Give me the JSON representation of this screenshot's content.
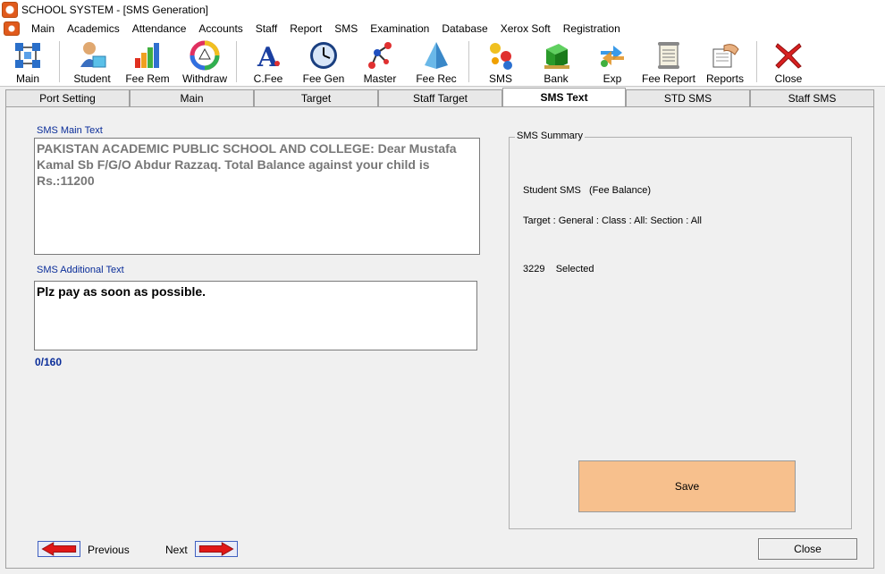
{
  "window": {
    "title": "SCHOOL SYSTEM - [SMS Generation]"
  },
  "menu": [
    "Main",
    "Academics",
    "Attendance",
    "Accounts",
    "Staff",
    "Report",
    "SMS",
    "Examination",
    "Database",
    "Xerox Soft",
    "Registration"
  ],
  "toolbar": [
    {
      "label": "Main",
      "icon": "grid-icon"
    },
    {
      "label": "Student",
      "icon": "student-icon"
    },
    {
      "label": "Fee Rem",
      "icon": "bar-chart-icon"
    },
    {
      "label": "Withdraw",
      "icon": "color-wheel-icon"
    },
    {
      "label": "C.Fee",
      "icon": "letter-a-icon"
    },
    {
      "label": "Fee Gen",
      "icon": "clock-icon"
    },
    {
      "label": "Master",
      "icon": "molecule-icon"
    },
    {
      "label": "Fee Rec",
      "icon": "pyramid-icon"
    },
    {
      "label": "SMS",
      "icon": "balls-icon"
    },
    {
      "label": "Bank",
      "icon": "cube-icon"
    },
    {
      "label": "Exp",
      "icon": "exchange-arrows-icon"
    },
    {
      "label": "Fee Report",
      "icon": "scroll-icon"
    },
    {
      "label": "Reports",
      "icon": "handshake-icon"
    },
    {
      "label": "Close",
      "icon": "close-x-icon"
    }
  ],
  "tabs": [
    "Port Setting",
    "Main",
    "Target",
    "Staff Target",
    "SMS Text",
    "STD SMS",
    "Staff SMS"
  ],
  "active_tab": "SMS Text",
  "sms": {
    "main_label": "SMS Main Text",
    "main_text": "PAKISTAN ACADEMIC PUBLIC SCHOOL AND COLLEGE: Dear Mustafa Kamal Sb F/G/O Abdur Razzaq. Total Balance against your child is Rs.:11200",
    "additional_label": "SMS Additional Text",
    "additional_text": "Plz pay as soon as possible.",
    "counter": "0/160"
  },
  "summary": {
    "title": "SMS Summary",
    "line1": "Student SMS   (Fee Balance)",
    "line2": "Target : General : Class : All: Section : All",
    "line3": "3229    Selected"
  },
  "buttons": {
    "save": "Save",
    "previous": "Previous",
    "next": "Next",
    "close": "Close"
  },
  "colors": {
    "save_bg": "#f7c08d",
    "label_blue": "#0a2d99",
    "arrow_red": "#e01818"
  }
}
